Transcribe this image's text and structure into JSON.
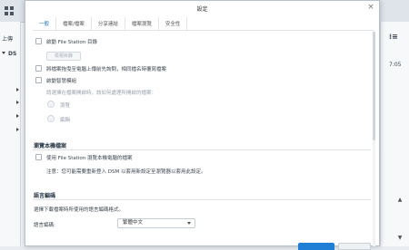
{
  "background": {
    "toolbar_button_label": "上傳",
    "tree_root_label": "DS",
    "right_time": "7:05",
    "right_icon_label": "⁞≡"
  },
  "dialog": {
    "title": "設定",
    "tabs": [
      {
        "label": "一般",
        "active": true
      },
      {
        "label": "檔案/檔案"
      },
      {
        "label": "分享連結"
      },
      {
        "label": "檔案瀏覽"
      },
      {
        "label": "安全性"
      }
    ],
    "general": {
      "open_file_station_label": "啟動 File Station 目錄",
      "edit_button_label": "檢視目錄",
      "same_name_label": "將檔案拖曳至電腦上傳前先詢問，相同檔名時覆寫檔案",
      "smart_label": "啟動智慧模組",
      "smart_desc": "請選擇在檔案開啟時，該如何處理所開啟的檔案：",
      "radio_1": "瀏覽",
      "radio_2": "編輯"
    },
    "browse": {
      "section_title": "瀏覽本機檔案",
      "use_label": "使用 File Station 瀏覽本機電腦的檔案",
      "note": "注意：您可能需要重新登入 DSM 以套用新設定至瀏覽器以套用此設定。"
    },
    "encoding": {
      "section_title": "語言編碼",
      "desc": "選擇下載檔案時所使用的語言編碼格式。",
      "field_label": "語言編碼:",
      "selected": "繁體中文"
    }
  },
  "colors": {
    "accent": "#0f6fc6",
    "primary_button": "#1f7fd6"
  }
}
